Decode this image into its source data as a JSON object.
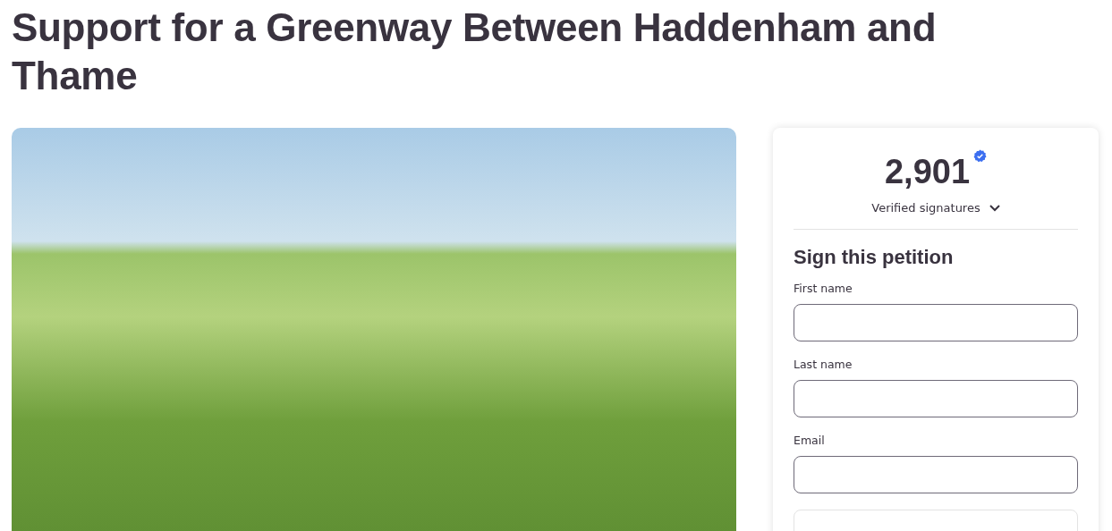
{
  "title": "Support for a Greenway Between Haddenham and Thame",
  "signatures": {
    "count": "2,901",
    "verified": true,
    "label": "Verified signatures",
    "expanded": false
  },
  "form": {
    "heading": "Sign this petition",
    "fields": [
      {
        "kind": "labeled",
        "label": "First name"
      },
      {
        "kind": "labeled",
        "label": "Last name"
      },
      {
        "kind": "labeled",
        "label": "Email"
      },
      {
        "kind": "cut-off"
      }
    ]
  }
}
